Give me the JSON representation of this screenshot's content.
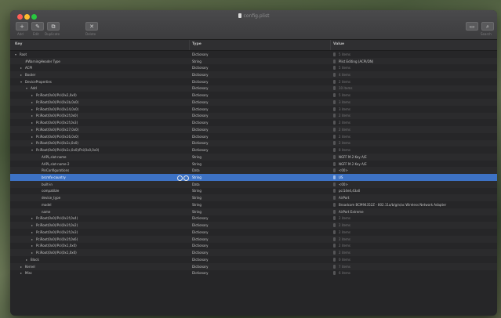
{
  "window": {
    "title": "config.plist"
  },
  "toolbar": {
    "buttons": [
      {
        "glyph": "+",
        "label": "Add"
      },
      {
        "glyph": "✎",
        "label": "Edit"
      },
      {
        "glyph": "⧉",
        "label": "Duplicate"
      },
      {
        "glyph": "✕",
        "label": "Delete"
      }
    ],
    "right_buttons": [
      {
        "glyph": "▭",
        "label": ""
      },
      {
        "glyph": "⌕",
        "label": "Search"
      }
    ]
  },
  "columns": {
    "key": "Key",
    "type": "Type",
    "value": "Value"
  },
  "rows": [
    {
      "key": "Root",
      "type": "Dictionary",
      "value": "5 items",
      "dim": true,
      "depth": 0,
      "disc": "▾"
    },
    {
      "key": "#WarningHeader Type",
      "type": "String",
      "value": "Plist Editing (ACPI/DN)",
      "dim": false,
      "depth": 1,
      "disc": ""
    },
    {
      "key": "ACPI",
      "type": "Dictionary",
      "value": "5 items",
      "dim": true,
      "depth": 1,
      "disc": "▸"
    },
    {
      "key": "Booter",
      "type": "Dictionary",
      "value": "4 items",
      "dim": true,
      "depth": 1,
      "disc": "▸"
    },
    {
      "key": "DeviceProperties",
      "type": "Dictionary",
      "value": "2 items",
      "dim": true,
      "depth": 1,
      "disc": "▾"
    },
    {
      "key": "Add",
      "type": "Dictionary",
      "value": "10 items",
      "dim": true,
      "depth": 2,
      "disc": "▾"
    },
    {
      "key": "PciRoot(0x0)/Pci(0x2,0x0)",
      "type": "Dictionary",
      "value": "5 items",
      "dim": true,
      "depth": 3,
      "disc": "▸"
    },
    {
      "key": "PciRoot(0x0)/Pci(0x1b,0x0)",
      "type": "Dictionary",
      "value": "3 items",
      "dim": true,
      "depth": 3,
      "disc": "▸"
    },
    {
      "key": "PciRoot(0x0)/Pci(0x14,0x0)",
      "type": "Dictionary",
      "value": "3 items",
      "dim": true,
      "depth": 3,
      "disc": "▸"
    },
    {
      "key": "PciRoot(0x0)/Pci(0x1f,0x0)",
      "type": "Dictionary",
      "value": "2 items",
      "dim": true,
      "depth": 3,
      "disc": "▸"
    },
    {
      "key": "PciRoot(0x0)/Pci(0x1f,0x3)",
      "type": "Dictionary",
      "value": "2 items",
      "dim": true,
      "depth": 3,
      "disc": "▸"
    },
    {
      "key": "PciRoot(0x0)/Pci(0x17,0x0)",
      "type": "Dictionary",
      "value": "2 items",
      "dim": true,
      "depth": 3,
      "disc": "▸"
    },
    {
      "key": "PciRoot(0x0)/Pci(0x16,0x0)",
      "type": "Dictionary",
      "value": "2 items",
      "dim": true,
      "depth": 3,
      "disc": "▸"
    },
    {
      "key": "PciRoot(0x0)/Pci(0x1c,0x0)",
      "type": "Dictionary",
      "value": "2 items",
      "dim": true,
      "depth": 3,
      "disc": "▸"
    },
    {
      "key": "PciRoot(0x0)/Pci(0x1c,0x0)/Pci(0x0,0x0)",
      "type": "Dictionary",
      "value": "8 items",
      "dim": true,
      "depth": 3,
      "disc": "▾"
    },
    {
      "key": "AAPL,slot-name",
      "type": "String",
      "value": "NGFF M.2 Key A/E",
      "dim": false,
      "depth": 4,
      "disc": ""
    },
    {
      "key": "AAPL,slot-name-2",
      "type": "String",
      "value": "NGFF M.2 Key A/E",
      "dim": false,
      "depth": 4,
      "disc": ""
    },
    {
      "key": "PinConfigurations",
      "type": "Data",
      "value": "<00>",
      "dim": false,
      "depth": 4,
      "disc": ""
    },
    {
      "key": "brcmfx-country",
      "type": "String",
      "value": "US",
      "dim": false,
      "depth": 4,
      "disc": "",
      "selected": true
    },
    {
      "key": "built-in",
      "type": "Data",
      "value": "<00>",
      "dim": false,
      "depth": 4,
      "disc": ""
    },
    {
      "key": "compatible",
      "type": "String",
      "value": "pci14e4,43a0",
      "dim": false,
      "depth": 4,
      "disc": ""
    },
    {
      "key": "device_type",
      "type": "String",
      "value": "AirPort",
      "dim": false,
      "depth": 4,
      "disc": ""
    },
    {
      "key": "model",
      "type": "String",
      "value": "Broadcom BCM94352Z - 802.11a/b/g/n/ac Wireless Network Adapter",
      "dim": false,
      "depth": 4,
      "disc": ""
    },
    {
      "key": "name",
      "type": "String",
      "value": "AirPort Extreme",
      "dim": false,
      "depth": 4,
      "disc": ""
    },
    {
      "key": "PciRoot(0x0)/Pci(0x1f,0x4)",
      "type": "Dictionary",
      "value": "2 items",
      "dim": true,
      "depth": 3,
      "disc": "▸"
    },
    {
      "key": "PciRoot(0x0)/Pci(0x1f,0x2)",
      "type": "Dictionary",
      "value": "2 items",
      "dim": true,
      "depth": 3,
      "disc": "▸"
    },
    {
      "key": "PciRoot(0x0)/Pci(0x1f,0x3)",
      "type": "Dictionary",
      "value": "2 items",
      "dim": true,
      "depth": 3,
      "disc": "▸"
    },
    {
      "key": "PciRoot(0x0)/Pci(0x1f,0x6)",
      "type": "Dictionary",
      "value": "2 items",
      "dim": true,
      "depth": 3,
      "disc": "▸"
    },
    {
      "key": "PciRoot(0x0)/Pci(0x1,0x0)",
      "type": "Dictionary",
      "value": "2 items",
      "dim": true,
      "depth": 3,
      "disc": "▸"
    },
    {
      "key": "PciRoot(0x0)/Pci(0x1,0x0)",
      "type": "Dictionary",
      "value": "2 items",
      "dim": true,
      "depth": 3,
      "disc": "▸"
    },
    {
      "key": "Block",
      "type": "Dictionary",
      "value": "0 items",
      "dim": true,
      "depth": 2,
      "disc": "▸"
    },
    {
      "key": "Kernel",
      "type": "Dictionary",
      "value": "7 items",
      "dim": true,
      "depth": 1,
      "disc": "▸"
    },
    {
      "key": "Misc",
      "type": "Dictionary",
      "value": "6 items",
      "dim": true,
      "depth": 1,
      "disc": "▸"
    }
  ]
}
